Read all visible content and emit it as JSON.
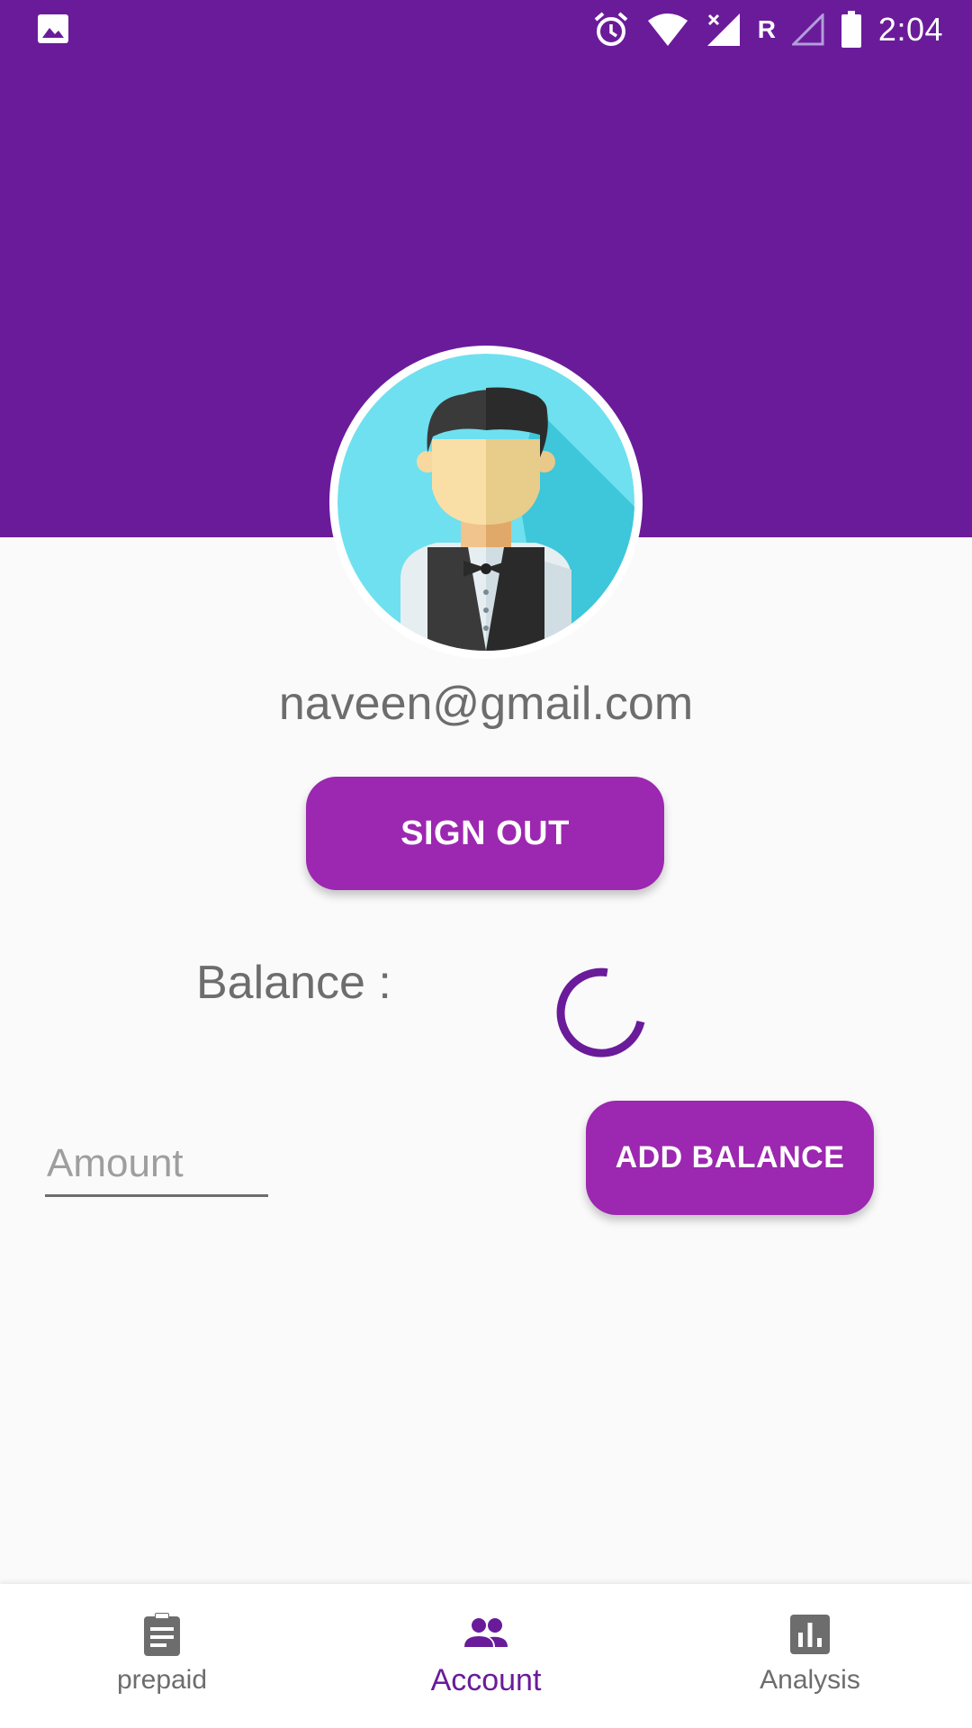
{
  "status_bar": {
    "time": "2:04",
    "network_label": "R",
    "left_icon": "image-icon",
    "icons": [
      "alarm-icon",
      "wifi-icon",
      "signal-icon",
      "signal-empty-icon",
      "battery-icon"
    ]
  },
  "colors": {
    "header": "#6a1b9a",
    "button": "#9c27b0",
    "accent": "#6a1b9a",
    "text_gray": "#6d6d6d"
  },
  "profile": {
    "email": "naveen@gmail.com",
    "avatar_icon": "avatar-waiter-icon"
  },
  "actions": {
    "sign_out_label": "SIGN OUT",
    "add_balance_label": "ADD BALANCE"
  },
  "balance": {
    "label": "Balance :",
    "loading_icon": "spinner-icon"
  },
  "amount": {
    "placeholder": "Amount",
    "value": ""
  },
  "bottom_nav": {
    "items": [
      {
        "label": "prepaid",
        "icon": "clipboard-icon",
        "active": false
      },
      {
        "label": "Account",
        "icon": "people-icon",
        "active": true
      },
      {
        "label": "Analysis",
        "icon": "bar-chart-icon",
        "active": false
      }
    ]
  }
}
